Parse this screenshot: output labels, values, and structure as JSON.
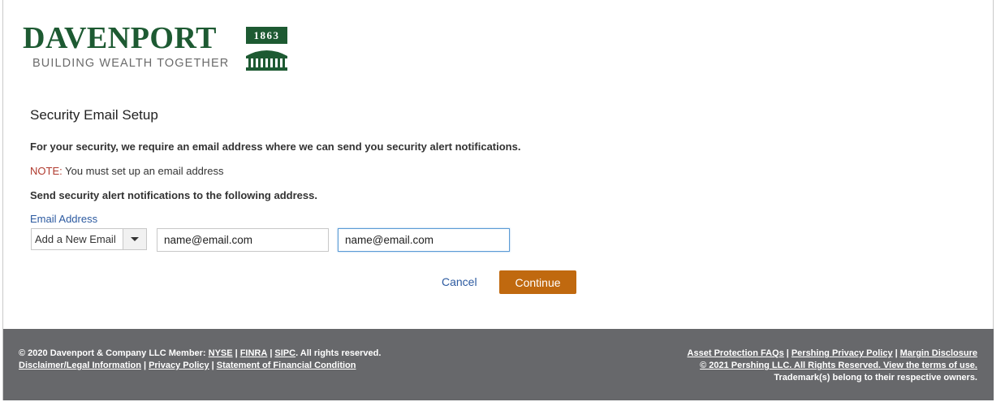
{
  "brand": {
    "name": "DAVENPORT",
    "tagline": "BUILDING WEALTH TOGETHER",
    "year": "1863",
    "color": "#1d5a32"
  },
  "page": {
    "title": "Security Email Setup",
    "description": "For your security, we require an email address where we can send you security alert notifications.",
    "note_label": "NOTE:",
    "note_text": " You must set up an email address",
    "send_text": "Send security alert notifications to the following address."
  },
  "form": {
    "email_label": "Email Address",
    "select_value": "Add a New Email",
    "email_value": "name@email.com",
    "confirm_email_value": "name@email.com"
  },
  "actions": {
    "cancel_label": "Cancel",
    "continue_label": "Continue",
    "continue_color": "#c0690f"
  },
  "footer": {
    "copyright_prefix": "© 2020 Davenport & Company LLC Member: ",
    "nyse": "NYSE",
    "finra": "FINRA",
    "sipc": "SIPC",
    "rights": ". All rights reserved.",
    "disclaimer": "Disclaimer/Legal Information",
    "privacy": "Privacy Policy",
    "statement": "Statement of Financial Condition",
    "asset_faq": "Asset Protection FAQs",
    "pershing_privacy": "Pershing Privacy Policy",
    "margin": "Margin Disclosure",
    "pershing_copyright": "© 2021 Pershing LLC. All Rights Reserved. View the terms of use.",
    "trademark": "Trademark(s) belong to their respective owners."
  }
}
